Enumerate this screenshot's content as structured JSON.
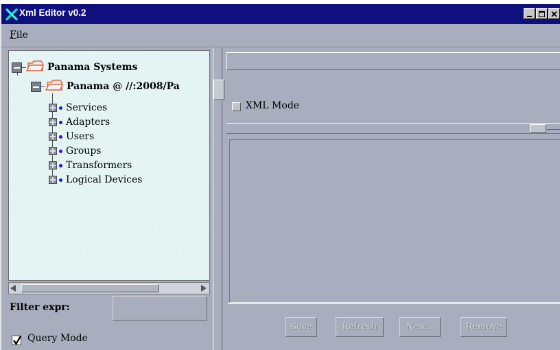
{
  "window": {
    "title": "Xml Editor v0.2",
    "controls": [
      "minimize-icon",
      "maximize-icon",
      "close-icon"
    ]
  },
  "menu": {
    "file_mnemonic": "F",
    "file_rest": "ile"
  },
  "tree": {
    "root": {
      "label": "Panama Systems",
      "icon": "folder-icon",
      "expanded": true
    },
    "server": {
      "label": "Panama @ //:2008/Pa",
      "icon": "folder-icon",
      "expanded": true
    },
    "items": [
      {
        "label": "Services"
      },
      {
        "label": "Adapters"
      },
      {
        "label": "Users"
      },
      {
        "label": "Groups"
      },
      {
        "label": "Transformers"
      },
      {
        "label": "Logical Devices"
      }
    ]
  },
  "filter": {
    "label": "Filter expr:",
    "value": ""
  },
  "query_mode": {
    "label": "Query Mode",
    "checked": true
  },
  "xml_mode": {
    "label": "XML Mode",
    "checked": false
  },
  "actions": {
    "save": "Save",
    "refresh": "Refresh",
    "new": "New...",
    "remove": "Remove",
    "enabled": false
  },
  "colors": {
    "title_bar": "#0f0f7e",
    "window_bg": "#a8aebd",
    "tree_bg": "#dff2f1",
    "tree_dot": "#1a1adc",
    "folder": "#f08a5d"
  }
}
